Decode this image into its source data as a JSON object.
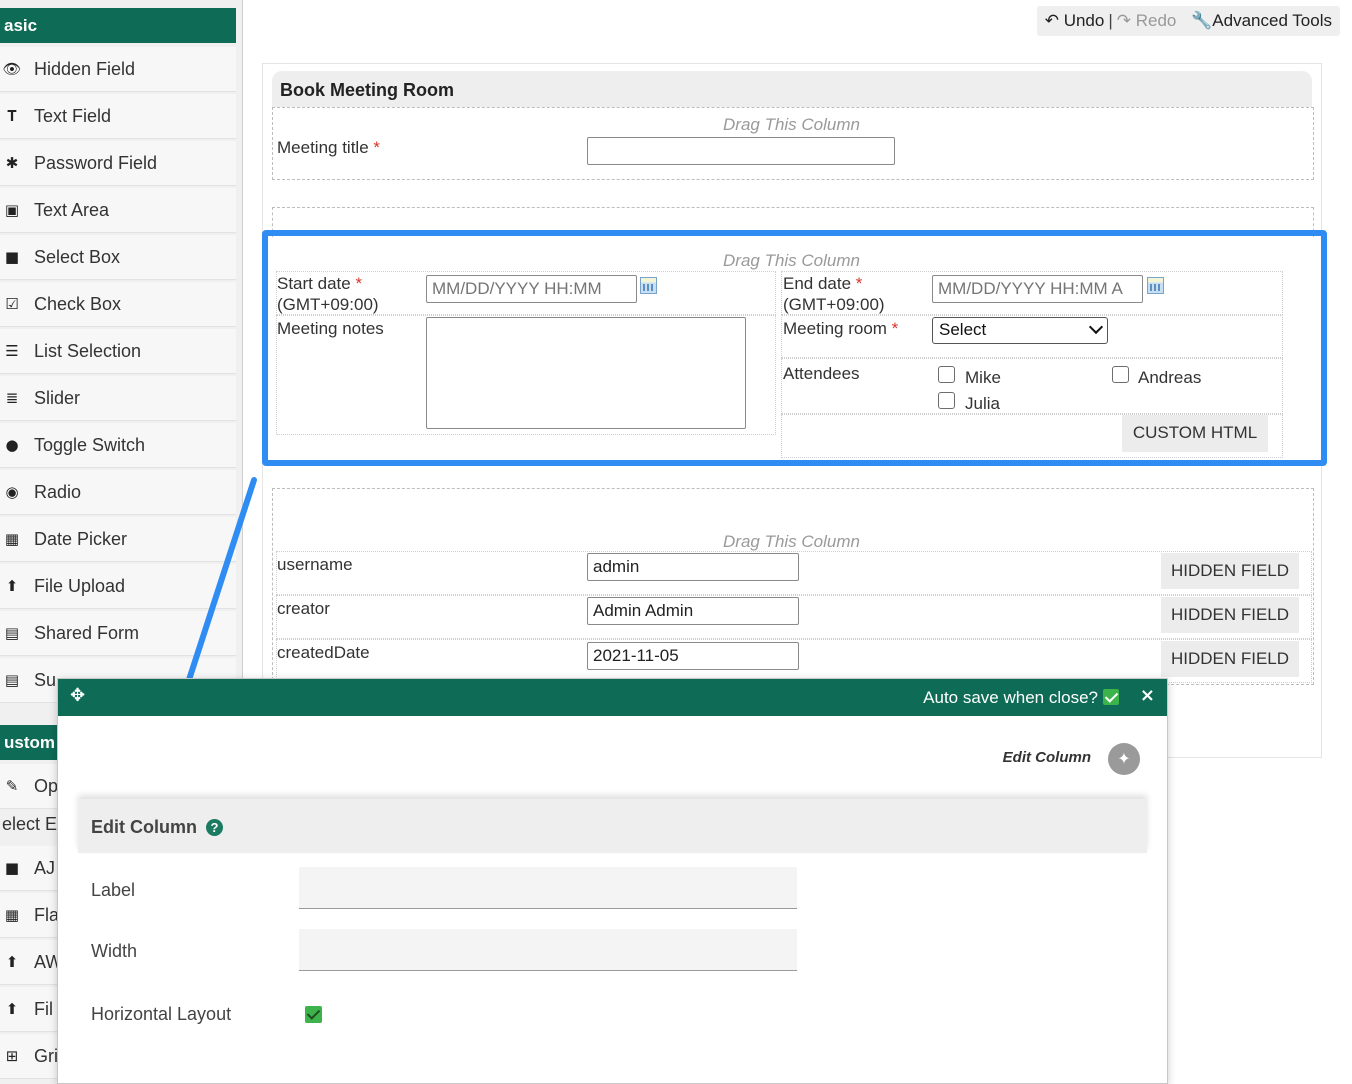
{
  "sidebar": {
    "basic_header": "asic",
    "items": [
      {
        "label": "Hidden Field",
        "icon": "hidden-field-icon"
      },
      {
        "label": "Text Field",
        "icon": "text-field-icon"
      },
      {
        "label": "Password Field",
        "icon": "password-field-icon"
      },
      {
        "label": "Text Area",
        "icon": "text-area-icon"
      },
      {
        "label": "Select Box",
        "icon": "select-box-icon"
      },
      {
        "label": "Check Box",
        "icon": "check-box-icon"
      },
      {
        "label": "List Selection",
        "icon": "list-selection-icon"
      },
      {
        "label": "Slider",
        "icon": "slider-icon"
      },
      {
        "label": "Toggle Switch",
        "icon": "toggle-switch-icon"
      },
      {
        "label": "Radio",
        "icon": "radio-icon"
      },
      {
        "label": "Date Picker",
        "icon": "date-picker-icon"
      },
      {
        "label": "File Upload",
        "icon": "file-upload-icon"
      },
      {
        "label": "Shared Form",
        "icon": "shared-form-icon"
      },
      {
        "label": "Su",
        "icon": "subform-icon"
      }
    ],
    "custom_header": "ustom",
    "custom_items": [
      {
        "label": "Op",
        "icon": "options-icon"
      },
      {
        "label": "elect E",
        "icon": ""
      },
      {
        "label": "AJ",
        "icon": "ajax-select-icon"
      },
      {
        "label": "Fla",
        "icon": "calendar-icon"
      },
      {
        "label": "AW",
        "icon": "upload-icon"
      },
      {
        "label": "Fil",
        "icon": "file-icon"
      },
      {
        "label": "Gri",
        "icon": "grid-icon"
      }
    ]
  },
  "toolbar": {
    "undo": "Undo",
    "redo": "Redo",
    "advanced": "Advanced Tools"
  },
  "form": {
    "section_title": "Book Meeting Room",
    "drag_label": "Drag This Column",
    "meeting_title": "Meeting title",
    "start_date": "Start date",
    "start_tz": "(GMT+09:00)",
    "start_placeholder": "MM/DD/YYYY HH:MM",
    "end_date": "End date",
    "end_tz": "(GMT+09:00)",
    "end_placeholder": "MM/DD/YYYY HH:MM A",
    "meeting_notes": "Meeting notes",
    "meeting_room": "Meeting room",
    "meeting_room_value": "Select",
    "attendees": "Attendees",
    "attendee_options": [
      "Mike",
      "Andreas",
      "Julia"
    ],
    "custom_html": "CUSTOM HTML",
    "required_mark": "*",
    "hidden_rows": [
      {
        "label": "username",
        "value": "admin",
        "tag": "HIDDEN FIELD"
      },
      {
        "label": "creator",
        "value": "Admin Admin",
        "tag": "HIDDEN FIELD"
      },
      {
        "label": "createdDate",
        "value": "2021-11-05",
        "tag": "HIDDEN FIELD"
      }
    ]
  },
  "dialog": {
    "auto_save": "Auto save when close?",
    "close": "×",
    "edit_column_link": "Edit Column",
    "panel_title": "Edit Column",
    "help": "?",
    "label_field": "Label",
    "label_value": "",
    "width_field": "Width",
    "width_value": "",
    "horizontal_layout": "Horizontal Layout",
    "horizontal_layout_checked": true
  },
  "colors": {
    "brand_green": "#0e6b55",
    "highlight_blue": "#2f8cf2",
    "required_red": "#d9342b",
    "check_green": "#3cb44b"
  }
}
